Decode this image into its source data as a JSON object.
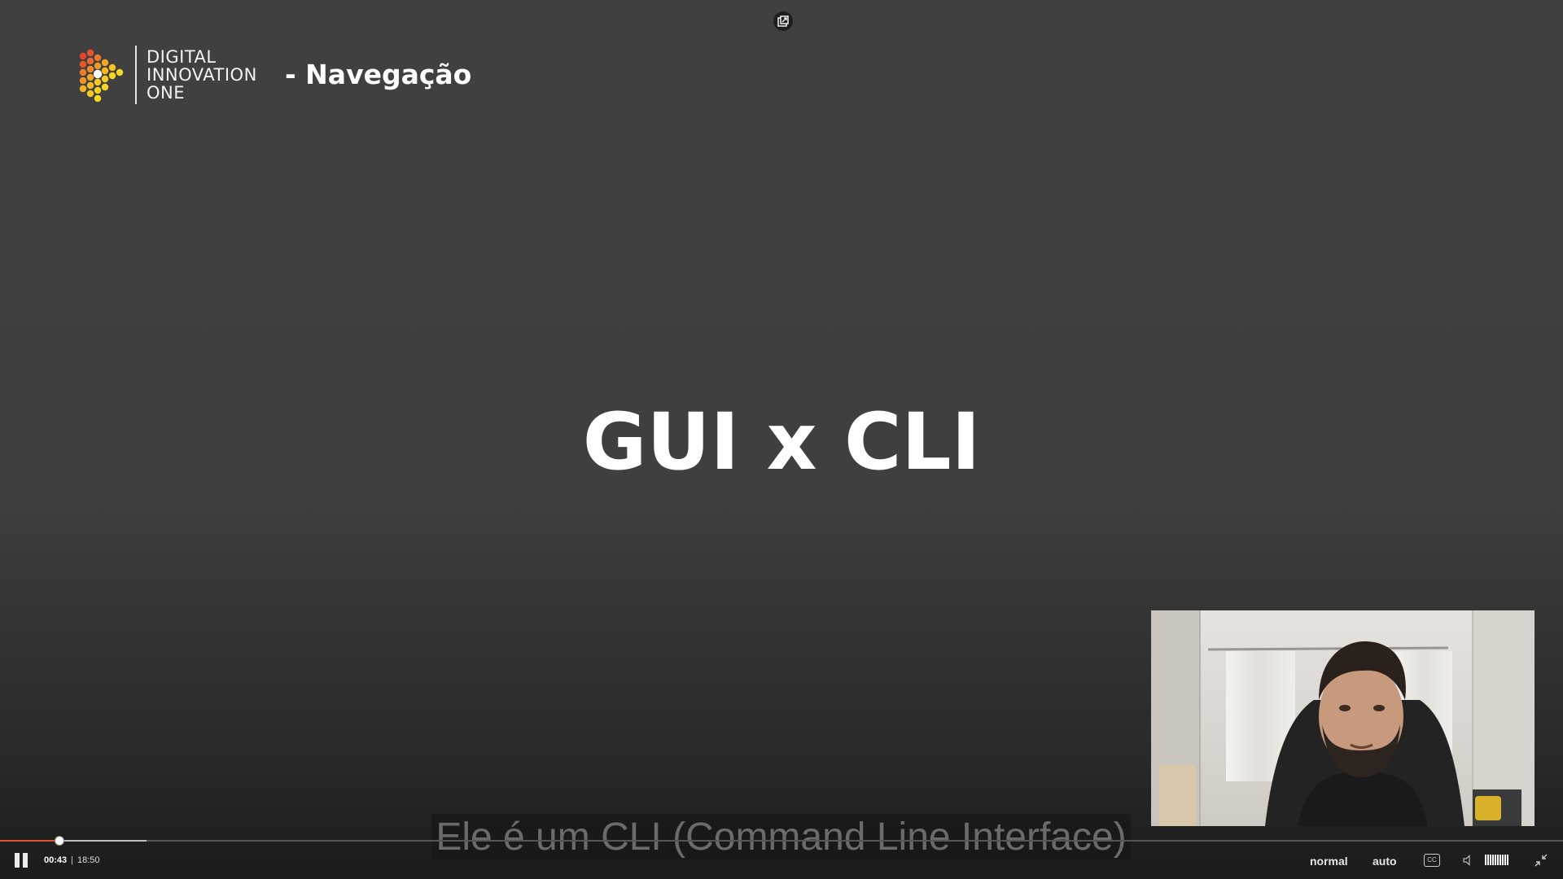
{
  "slide": {
    "brand": {
      "line1": "DIGITAL",
      "line2": "INNOVATION",
      "line3": "ONE"
    },
    "section_title": "- Navegação",
    "heading": "GUI x CLI"
  },
  "caption": {
    "text": "Ele é um CLI (Command Line Interface)"
  },
  "playback": {
    "current_time": "00:43",
    "separator": "|",
    "duration": "18:50",
    "played_fraction": 0.038,
    "buffered_fraction": 0.094,
    "state": "playing"
  },
  "controls": {
    "speed_label": "normal",
    "quality_label": "auto",
    "cc_label": "CC",
    "volume_level": 1.0
  },
  "icons": {
    "pip": "picture-in-picture-icon",
    "pause": "pause-icon",
    "volume": "volume-icon",
    "exit_fullscreen": "exit-fullscreen-icon"
  },
  "colors": {
    "progress_played": "#e8502d",
    "background": "#404040"
  }
}
